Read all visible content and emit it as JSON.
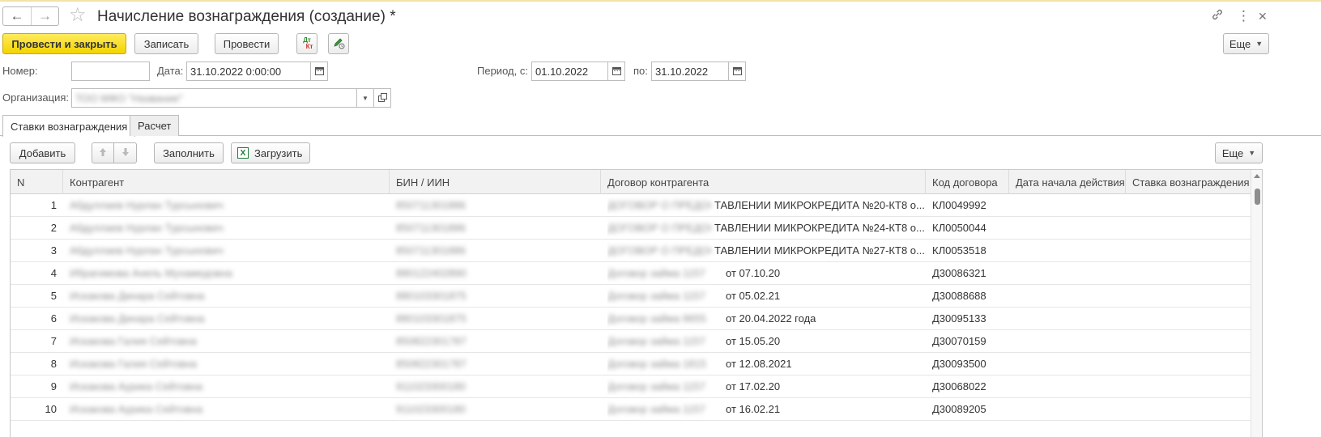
{
  "window": {
    "title": "Начисление вознаграждения (создание) *",
    "back_icon": "←",
    "forward_icon": "→",
    "star_icon": "☆",
    "link_icon": "🔗",
    "menu_icon": "⋮",
    "close_icon": "✕"
  },
  "toolbar": {
    "post_close_label": "Провести и закрыть",
    "save_label": "Записать",
    "post_label": "Провести",
    "dt_label": "Дт",
    "kt_label": "Кт",
    "more_label": "Еще"
  },
  "form": {
    "number_label": "Номер:",
    "number_value": "",
    "date_label": "Дата:",
    "date_value": "31.10.2022  0:00:00",
    "period_from_label": "Период, с:",
    "period_from_value": "01.10.2022",
    "period_to_label": "по:",
    "period_to_value": "31.10.2022",
    "org_label": "Организация:",
    "org_value": "ТОО МФО \"Название\""
  },
  "tabs": [
    {
      "label": "Ставки вознаграждения",
      "active": true
    },
    {
      "label": "Расчет",
      "active": false
    }
  ],
  "table_toolbar": {
    "add_label": "Добавить",
    "fill_label": "Заполнить",
    "load_label": "Загрузить",
    "more_label": "Еще"
  },
  "table": {
    "columns": [
      "N",
      "Контрагент",
      "БИН / ИИН",
      "Договор контрагента",
      "Код договора",
      "Дата начала действия",
      "Ставка вознаграждения"
    ],
    "rows": [
      {
        "n": "1",
        "contractor": "Абдуллаев Нурлан Турсынович",
        "bin": "850711301886",
        "contract_hidden": "ДОГОВОР О ПРЕДОС",
        "contract_visible": "ТАВЛЕНИИ МИКРОКРЕДИТА №20-КТ8 о...",
        "code": "КЛ0049992",
        "start_date": "",
        "rate": ""
      },
      {
        "n": "2",
        "contractor": "Абдуллаев Нурлан Турсынович",
        "bin": "850711301886",
        "contract_hidden": "ДОГОВОР О ПРЕДОС",
        "contract_visible": "ТАВЛЕНИИ МИКРОКРЕДИТА №24-КТ8 о...",
        "code": "КЛ0050044",
        "start_date": "",
        "rate": ""
      },
      {
        "n": "3",
        "contractor": "Абдуллаев Нурлан Турсынович",
        "bin": "850711301886",
        "contract_hidden": "ДОГОВОР О ПРЕДОС",
        "contract_visible": "ТАВЛЕНИИ МИКРОКРЕДИТА №27-КТ8 о...",
        "code": "КЛ0053518",
        "start_date": "",
        "rate": ""
      },
      {
        "n": "4",
        "contractor": "Ибрагимова Анель Мухамедовна",
        "bin": "880122402890",
        "contract_hidden": "Договор займа 1157",
        "contract_visible": "от 07.10.20",
        "code": "Д30086321",
        "start_date": "",
        "rate": ""
      },
      {
        "n": "5",
        "contractor": "Искакова Динара Сейтовна",
        "bin": "880103301875",
        "contract_hidden": "Договор займа 1157",
        "contract_visible": "от 05.02.21",
        "code": "Д30088688",
        "start_date": "",
        "rate": ""
      },
      {
        "n": "6",
        "contractor": "Искакова Динара Сейтовна",
        "bin": "880103301875",
        "contract_hidden": "Договор займа 9655",
        "contract_visible": "от 20.04.2022 года",
        "code": "Д30095133",
        "start_date": "",
        "rate": ""
      },
      {
        "n": "7",
        "contractor": "Искакова Галия Сейтовна",
        "bin": "850822301787",
        "contract_hidden": "Договор займа 1157",
        "contract_visible": "от 15.05.20",
        "code": "Д30070159",
        "start_date": "",
        "rate": ""
      },
      {
        "n": "8",
        "contractor": "Искакова Галия Сейтовна",
        "bin": "850822301787",
        "contract_hidden": "Договор займа 1815",
        "contract_visible": "от 12.08.2021",
        "code": "Д30093500",
        "start_date": "",
        "rate": ""
      },
      {
        "n": "9",
        "contractor": "Искакова Аурика Сейтовна",
        "bin": "911023300180",
        "contract_hidden": "Договор займа 1157",
        "contract_visible": "от 17.02.20",
        "code": "Д30068022",
        "start_date": "",
        "rate": ""
      },
      {
        "n": "10",
        "contractor": "Искакова Аурика Сейтовна",
        "bin": "911023300180",
        "contract_hidden": "Договор займа 1157",
        "contract_visible": "от 16.02.21",
        "code": "Д30089205",
        "start_date": "",
        "rate": ""
      }
    ]
  },
  "colors": {
    "primary_button": "#f4d400",
    "header_bg": "#f2f2f2",
    "border": "#c8c8c8"
  }
}
